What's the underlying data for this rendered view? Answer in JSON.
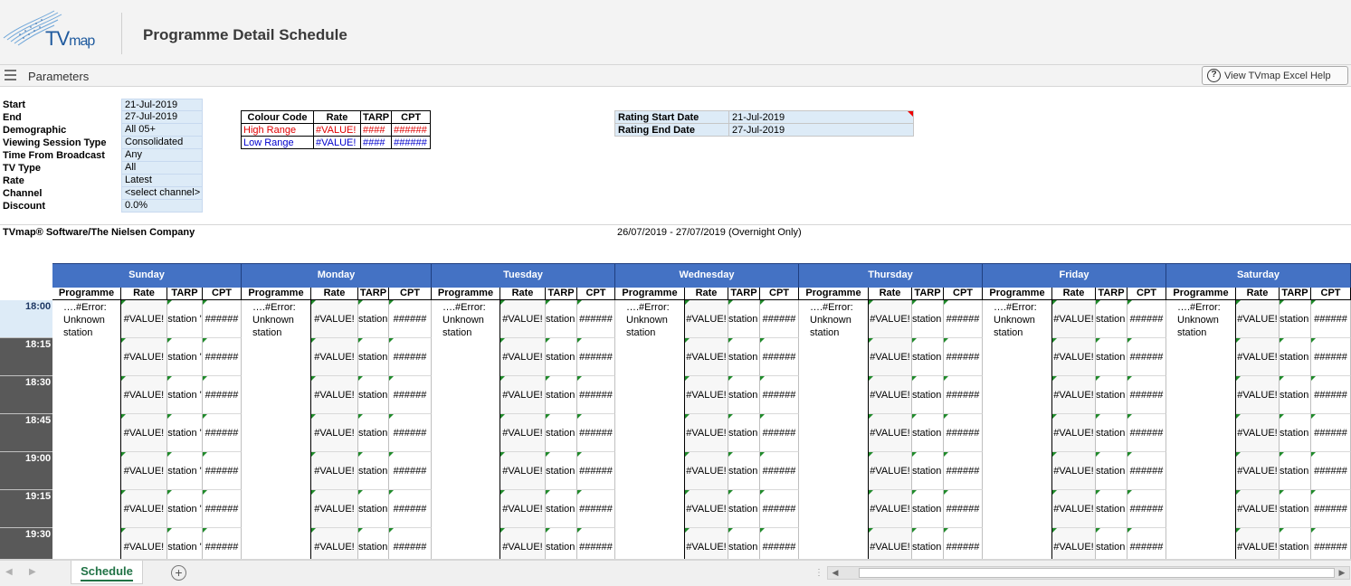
{
  "header": {
    "logo_text": "TV",
    "logo_suffix": "map",
    "title": "Programme Detail Schedule"
  },
  "params_bar": {
    "label": "Parameters",
    "help_label": "View TVmap Excel Help",
    "help_icon": "question-circle-icon"
  },
  "parameters": [
    {
      "label": "Start",
      "value": "21-Jul-2019"
    },
    {
      "label": "End",
      "value": "27-Jul-2019"
    },
    {
      "label": "Demographic",
      "value": "All 05+"
    },
    {
      "label": "Viewing Session Type",
      "value": "Consolidated"
    },
    {
      "label": "Time From Broadcast",
      "value": "Any"
    },
    {
      "label": "TV Type",
      "value": "All"
    },
    {
      "label": "Rate",
      "value": "Latest"
    },
    {
      "label": "Channel",
      "value": "<select channel>"
    },
    {
      "label": "Discount",
      "value": "0.0%"
    }
  ],
  "colour_code": {
    "headers": [
      "Colour Code",
      "Rate",
      "TARP",
      "CPT"
    ],
    "high": {
      "label": "High Range",
      "rate": "#VALUE!",
      "tarp": "####",
      "cpt": "######",
      "color": "#e00000"
    },
    "low": {
      "label": "Low Range",
      "rate": "#VALUE!",
      "tarp": "####",
      "cpt": "######",
      "color": "#0000cc"
    }
  },
  "rating": {
    "start_label": "Rating Start Date",
    "start_value": "21-Jul-2019",
    "end_label": "Rating End Date",
    "end_value": "27-Jul-2019"
  },
  "company": "TVmap® Software/The Nielsen Company",
  "date_range": "26/07/2019 - 27/07/2019 (Overnight Only)",
  "schedule": {
    "days": [
      "Sunday",
      "Monday",
      "Tuesday",
      "Wednesday",
      "Thursday",
      "Friday",
      "Saturday"
    ],
    "columns": [
      "Programme",
      "Rate",
      "TARP",
      "CPT"
    ],
    "times": [
      "18:00",
      "18:15",
      "18:30",
      "18:45",
      "19:00",
      "19:15",
      "19:30"
    ],
    "programme_text": "….#Error: Unknown station",
    "rate_value": "#VALUE!",
    "tarp_value": "station '",
    "cpt_value": "######"
  },
  "tabs": {
    "active": "Schedule"
  }
}
